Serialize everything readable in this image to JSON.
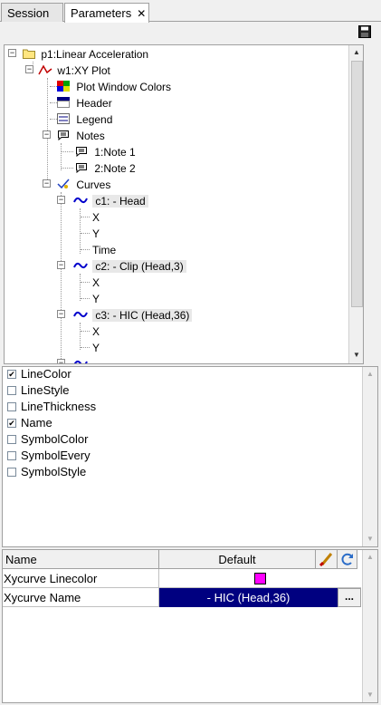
{
  "tabs": [
    {
      "label": "Session",
      "active": false
    },
    {
      "label": "Parameters",
      "active": true
    }
  ],
  "tab_close_glyph": "✕",
  "toolbar": {
    "icon": "save-icon"
  },
  "tree": {
    "root": "p1:Linear Acceleration",
    "window": "w1:XY Plot",
    "plot_window_colors": "Plot Window Colors",
    "header": "Header",
    "legend": "Legend",
    "notes": "Notes",
    "note1": "1:Note 1",
    "note2": "2:Note 2",
    "curves": "Curves",
    "c1": "c1: - Head",
    "c1_x": "X",
    "c1_y": "Y",
    "c1_time": "Time",
    "c2": "c2: - Clip (Head,3)",
    "c2_x": "X",
    "c2_y": "Y",
    "c3": "c3: - HIC (Head,36)",
    "c3_x": "X",
    "c3_y": "Y"
  },
  "attributes": [
    {
      "label": "LineColor",
      "checked": true
    },
    {
      "label": "LineStyle",
      "checked": false
    },
    {
      "label": "LineThickness",
      "checked": false
    },
    {
      "label": "Name",
      "checked": true
    },
    {
      "label": "SymbolColor",
      "checked": false
    },
    {
      "label": "SymbolEvery",
      "checked": false
    },
    {
      "label": "SymbolStyle",
      "checked": false
    }
  ],
  "table": {
    "col_name": "Name",
    "col_default": "Default",
    "rows": [
      {
        "name": "Xycurve Linecolor",
        "color": "#ff00ff"
      },
      {
        "name": "Xycurve Name",
        "value": "- HIC (Head,36)",
        "button": "..."
      }
    ]
  },
  "colors": {
    "selection": "#000080",
    "curve_icon": "#0000cc"
  }
}
